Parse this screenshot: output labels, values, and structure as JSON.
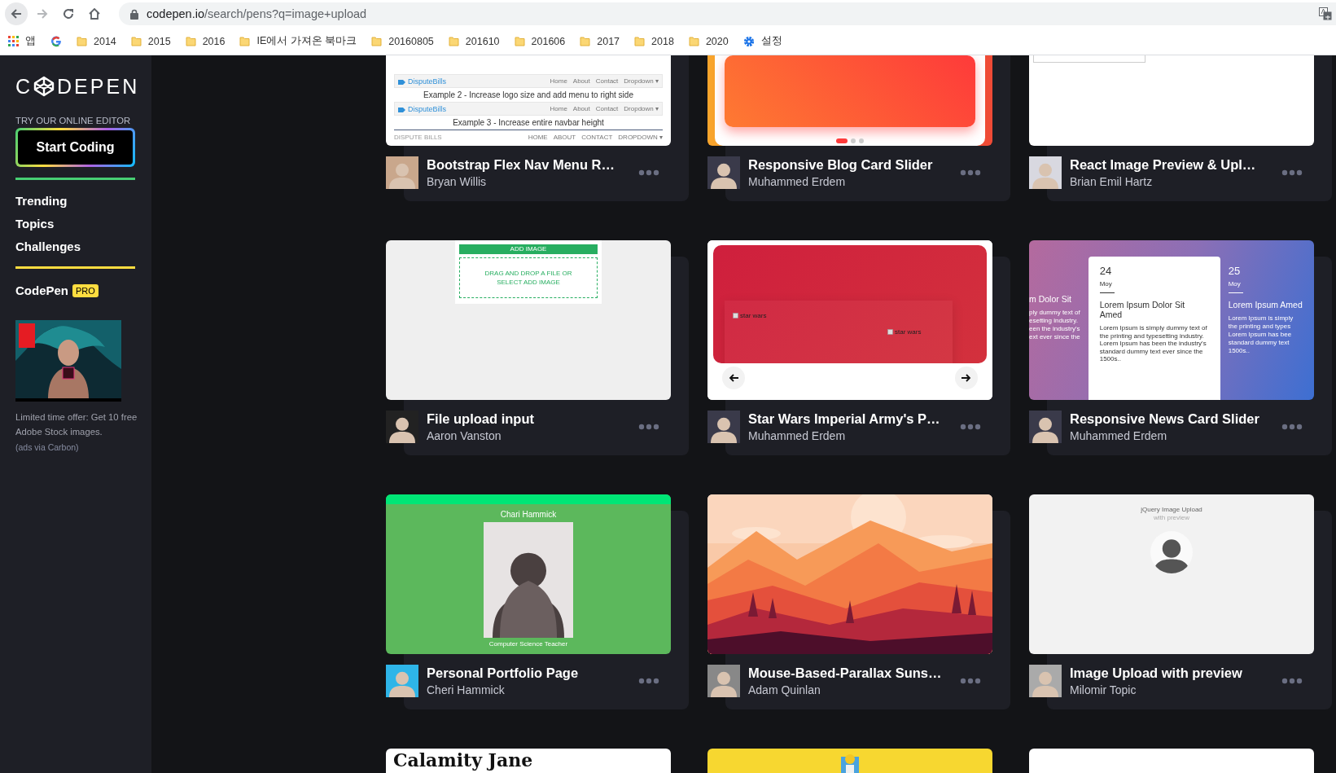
{
  "browser": {
    "url_host": "codepen.io",
    "url_path": "/search/pens?q=image+upload",
    "bookmarks": [
      {
        "kind": "apps",
        "label": "앱"
      },
      {
        "kind": "site"
      },
      {
        "kind": "folder",
        "label": "2014"
      },
      {
        "kind": "folder",
        "label": "2015"
      },
      {
        "kind": "folder",
        "label": "2016"
      },
      {
        "kind": "folder",
        "label": "IE에서 가져온 북마크"
      },
      {
        "kind": "folder",
        "label": "20160805"
      },
      {
        "kind": "folder",
        "label": "201610"
      },
      {
        "kind": "folder",
        "label": "201606"
      },
      {
        "kind": "folder",
        "label": "2017"
      },
      {
        "kind": "folder",
        "label": "2018"
      },
      {
        "kind": "folder",
        "label": "2020"
      },
      {
        "kind": "settings",
        "label": "설정"
      }
    ]
  },
  "sidebar": {
    "logo": [
      "C",
      "DEPEN"
    ],
    "editor_prompt": "TRY OUR ONLINE EDITOR",
    "start_button": "Start Coding",
    "nav": [
      {
        "label": "Trending"
      },
      {
        "label": "Topics"
      },
      {
        "label": "Challenges"
      }
    ],
    "pro": {
      "label": "CodePen",
      "badge": "PRO"
    },
    "ad": {
      "kind": "picture",
      "text": "Limited time offer: Get 10 free Adobe Stock images.",
      "via": "(ads via Carbon)"
    }
  },
  "pens": [
    {
      "title": "Bootstrap Flex Nav Menu R…",
      "author": "Bryan Willis",
      "preview": {
        "kind": "navbar-demo",
        "bars": [
          {
            "brand": "DisputeBills",
            "menu": [
              "Home",
              "About",
              "Contact",
              "Dropdown ▾"
            ]
          },
          {
            "brand": "DisputeBills",
            "menu": [
              "Home",
              "About",
              "Contact",
              "Dropdown ▾"
            ]
          }
        ],
        "captions": [
          "Example 2 - Increase logo size and add menu to right side",
          "Example 3 - Increase entire navbar height"
        ],
        "footer_brand": "DISPUTE BILLS",
        "footer_menu": [
          "HOME",
          "ABOUT",
          "CONTACT",
          "DROPDOWN ▾"
        ]
      }
    },
    {
      "title": "Responsive Blog Card Slider",
      "author": "Muhammed Erdem",
      "preview": {
        "kind": "gradient-slider"
      }
    },
    {
      "title": "React Image Preview & Upl…",
      "author": "Brian Emil Hartz",
      "preview": {
        "kind": "framed-doc"
      }
    },
    {
      "title": "File upload input",
      "author": "Aaron Vanston",
      "preview": {
        "kind": "upload-box",
        "button": "ADD IMAGE",
        "hint": "DRAG AND DROP A FILE OR SELECT ADD IMAGE"
      }
    },
    {
      "title": "Star Wars Imperial Army's P…",
      "author": "Muhammed Erdem",
      "preview": {
        "kind": "red-slider",
        "images": [
          "star wars",
          "star wars"
        ]
      }
    },
    {
      "title": "Responsive News Card Slider",
      "author": "Muhammed Erdem",
      "preview": {
        "kind": "news-cards",
        "left": {
          "heading": "m Dolor Sit",
          "lines": [
            "ply dummy text of",
            "esetting industry.",
            "een the industry's",
            "ext ever since the"
          ]
        },
        "center": {
          "day": "24",
          "month": "Moy",
          "heading": "Lorem Ipsum Dolor Sit Amed",
          "body": "Lorem Ipsum is simply dummy text of the printing and typesetting industry. Lorem Ipsum has been the industry's standard dummy text ever since the 1500s.."
        },
        "right": {
          "day": "25",
          "month": "Moy",
          "heading": "Lorem Ipsum Amed",
          "lines": [
            "Lorem Ipsum is simply",
            "the printing and types",
            "Lorem Ipsum has bee",
            "standard dummy text",
            "1500s.."
          ]
        }
      }
    },
    {
      "title": "Personal Portfolio Page",
      "author": "Cheri Hammick",
      "preview": {
        "kind": "portfolio",
        "name": "Chari Hammick",
        "role": "Computer Science Teacher"
      }
    },
    {
      "title": "Mouse-Based-Parallax Suns…",
      "author": "Adam Quinlan",
      "preview": {
        "kind": "landscape"
      }
    },
    {
      "title": "Image Upload with preview",
      "author": "Milomir Topic",
      "preview": {
        "kind": "profile-upload",
        "heading": "jQuery Image Upload",
        "sub": "with preview"
      }
    },
    {
      "preview": {
        "kind": "serif-title",
        "text": "Calamity Jane"
      }
    },
    {
      "preview": {
        "kind": "yellow-art"
      }
    },
    {
      "preview": {
        "kind": "blank-doc"
      }
    }
  ]
}
